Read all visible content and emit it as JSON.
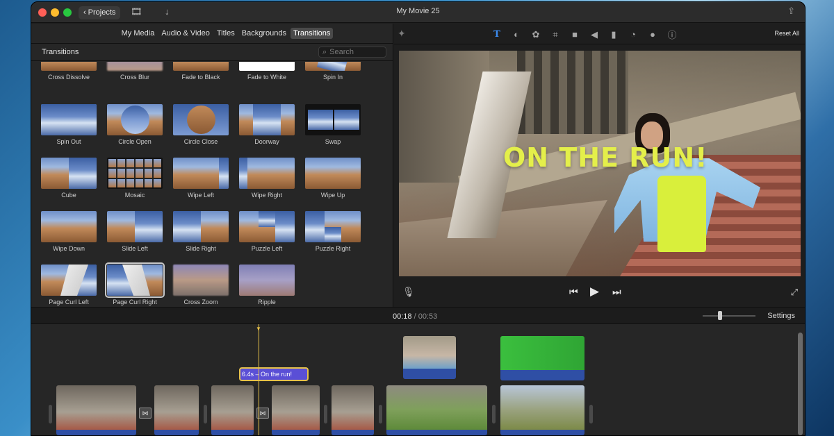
{
  "window": {
    "title": "My Movie 25",
    "projects_label": "Projects",
    "back_icon": "chevron-left-icon"
  },
  "browser": {
    "tabs": [
      "My Media",
      "Audio & Video",
      "Titles",
      "Backgrounds",
      "Transitions"
    ],
    "active_tab": "Transitions",
    "header": "Transitions",
    "search_placeholder": "Search",
    "items": [
      "Cross Dissolve",
      "Cross Blur",
      "Fade to Black",
      "Fade to White",
      "Spin In",
      "Spin Out",
      "Circle Open",
      "Circle Close",
      "Doorway",
      "Swap",
      "Cube",
      "Mosaic",
      "Wipe Left",
      "Wipe Right",
      "Wipe Up",
      "Wipe Down",
      "Slide Left",
      "Slide Right",
      "Puzzle Left",
      "Puzzle Right",
      "Page Curl Left",
      "Page Curl Right",
      "Cross Zoom",
      "Ripple"
    ],
    "selected_item": "Page Curl Right"
  },
  "viewer": {
    "reset_label": "Reset All",
    "title_overlay": "ON THE RUN!",
    "tools": [
      "text-icon",
      "color-balance-icon",
      "color-correction-icon",
      "crop-icon",
      "stabilization-icon",
      "volume-icon",
      "noise-reduction-icon",
      "speed-icon",
      "clip-filter-icon",
      "info-icon"
    ],
    "active_tool": "text-icon"
  },
  "timeline": {
    "current_time": "00:18",
    "separator": "/",
    "total_time": "00:53",
    "settings_label": "Settings",
    "title_clip_label": "6.4s – On the run!"
  },
  "colors": {
    "accent": "#3c8cf0",
    "title_yellow": "#e4ef4a",
    "clip_audio_blue": "#2f4fa5",
    "title_clip_purple": "#5a4fd6",
    "playhead": "#e6c14a"
  }
}
